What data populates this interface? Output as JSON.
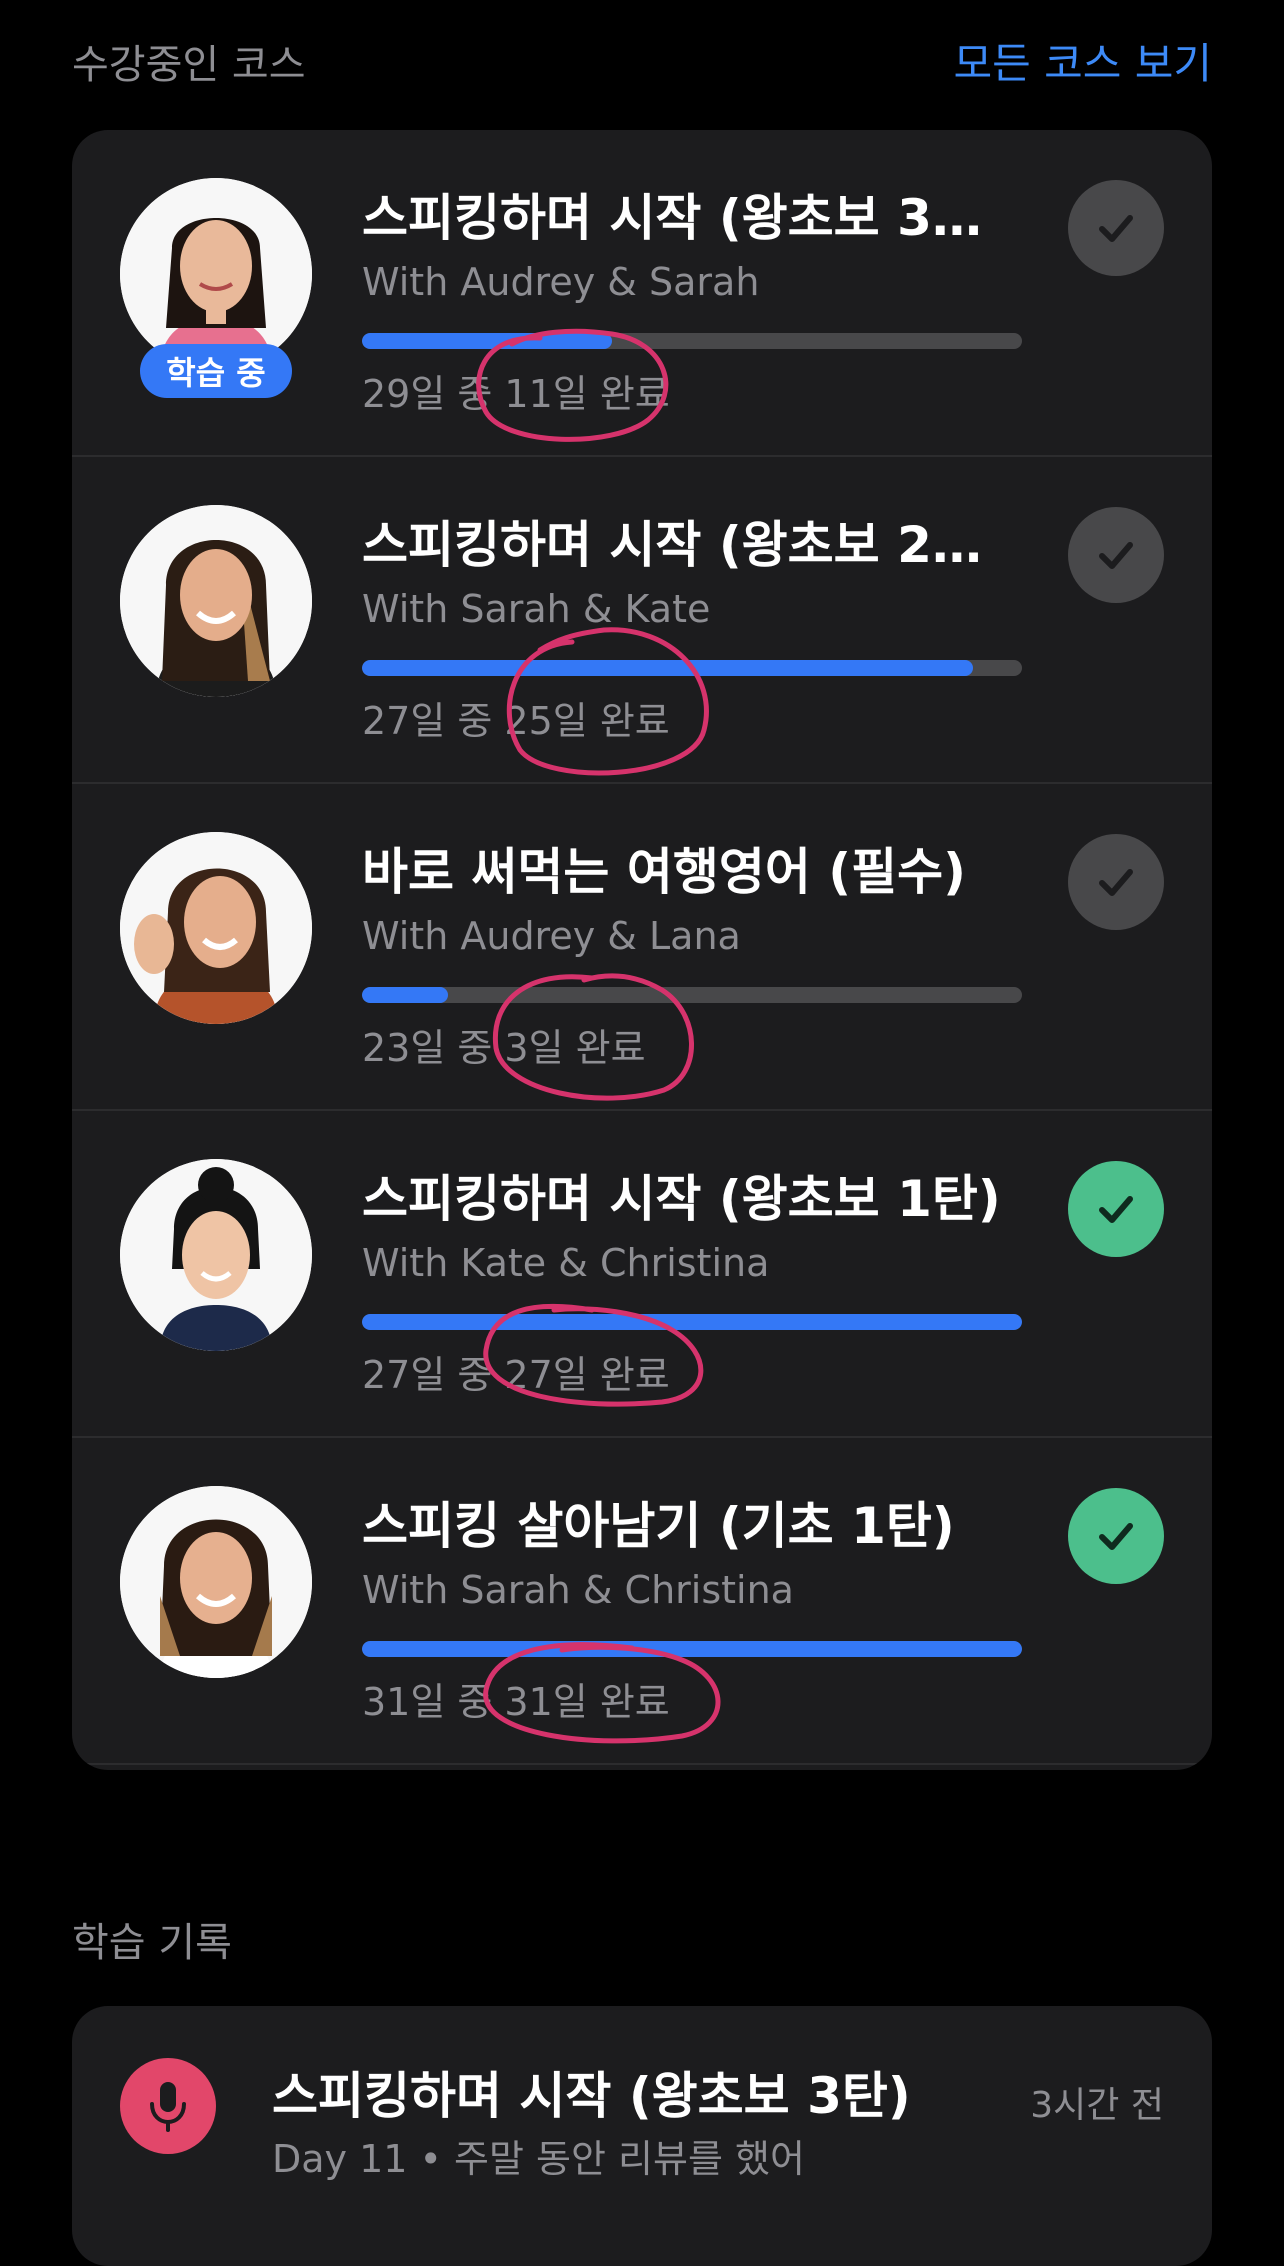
{
  "header": {
    "title": "수강중인 코스",
    "see_all": "모든 코스 보기"
  },
  "courses": [
    {
      "title": "스피킹하며 시작 (왕초보 3…",
      "instructors": "With Audrey & Sarah",
      "progress_text": "29일 중 11일 완료",
      "progress": 0.379,
      "completed": false,
      "badge": "학습 중",
      "check_icon": "checkmark-icon"
    },
    {
      "title": "스피킹하며 시작 (왕초보 2…",
      "instructors": "With Sarah & Kate",
      "progress_text": "27일 중 25일 완료",
      "progress": 0.926,
      "completed": false,
      "check_icon": "checkmark-icon"
    },
    {
      "title": "바로 써먹는 여행영어 (필수)",
      "instructors": "With Audrey & Lana",
      "progress_text": "23일 중 3일 완료",
      "progress": 0.13,
      "completed": false,
      "check_icon": "checkmark-icon"
    },
    {
      "title": "스피킹하며 시작 (왕초보 1탄)",
      "instructors": "With Kate & Christina",
      "progress_text": "27일 중 27일 완료",
      "progress": 1.0,
      "completed": true,
      "check_icon": "checkmark-icon"
    },
    {
      "title": "스피킹 살아남기 (기초 1탄)",
      "instructors": "With Sarah & Christina",
      "progress_text": "31일 중 31일 완료",
      "progress": 1.0,
      "completed": true,
      "check_icon": "checkmark-icon"
    }
  ],
  "history": {
    "section_title": "학습 기록",
    "item": {
      "title": "스피킹하며 시작 (왕초보 3탄)",
      "time": "3시간 전",
      "subtitle": "Day 11  •  주말 동안 리뷰를 했어",
      "icon": "microphone-icon"
    }
  },
  "colors": {
    "accent": "#3478f6",
    "done": "#4cbf8c",
    "annotation": "#d6336c"
  }
}
